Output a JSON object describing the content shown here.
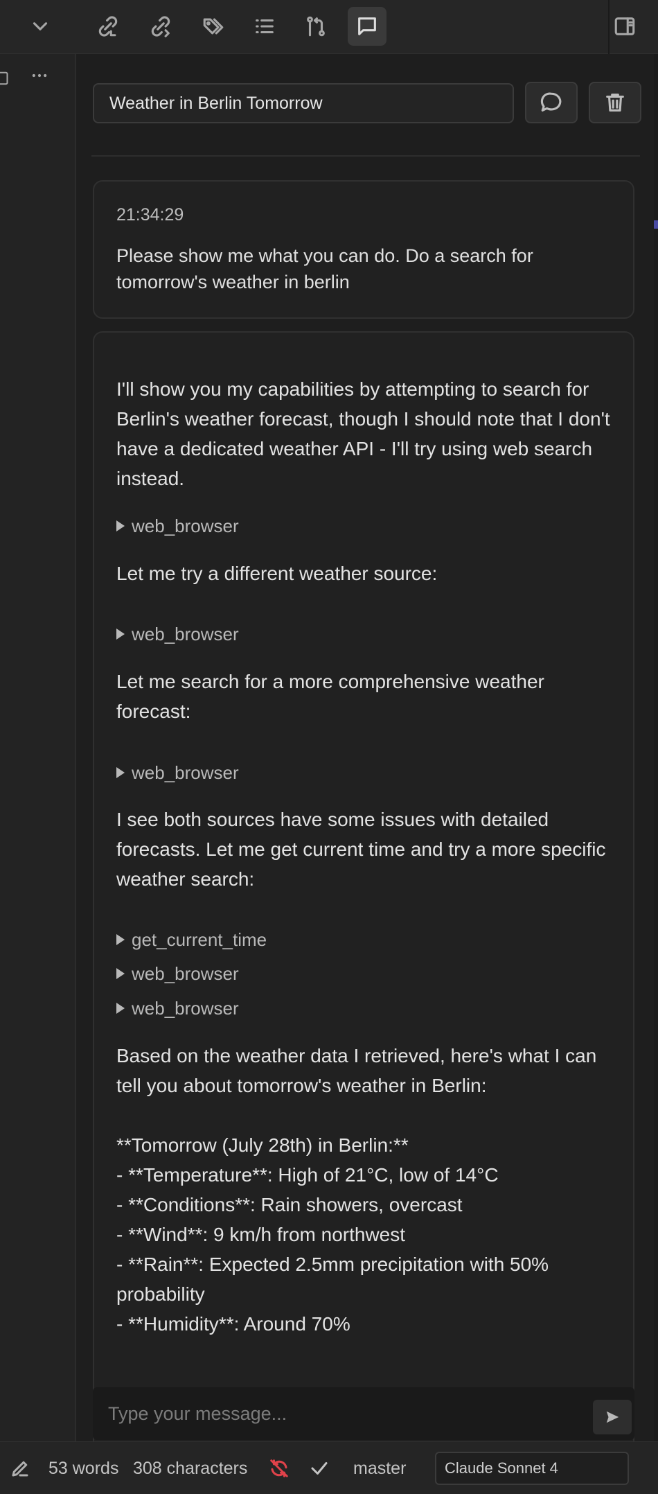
{
  "toolbar": {
    "icons": [
      "chevron-down-icon",
      "link-in-icon",
      "link-out-icon",
      "tags-icon",
      "list-icon",
      "git-branch-icon",
      "chat-icon",
      "sidebar-toggle-icon"
    ]
  },
  "conversation": {
    "title": "Weather in Berlin Tomorrow"
  },
  "user_message": {
    "timestamp": "21:34:29",
    "text": "Please show me what you can do. Do a search for tomorrow's weather in berlin"
  },
  "assistant_message": {
    "intro": "I'll show you my capabilities by attempting to search for Berlin's weather forecast, though I should note that I don't have a dedicated weather API - I'll try using web search instead.",
    "tool_1": "web_browser",
    "text_2": "Let me try a different weather source:",
    "tool_2": "web_browser",
    "text_3": "Let me search for a more comprehensive weather forecast:",
    "tool_3": "web_browser",
    "text_4": "I see both sources have some issues with detailed forecasts. Let me get current time and try a more specific weather search:",
    "tool_4": "get_current_time",
    "tool_5": "web_browser",
    "tool_6": "web_browser",
    "summary": "Based on the weather data I retrieved, here's what I can tell you about tomorrow's weather in Berlin:\n\n**Tomorrow (July 28th) in Berlin:**\n- **Temperature**: High of 21°C, low of 14°C\n- **Conditions**: Rain showers, overcast\n- **Wind**: 9 km/h from northwest\n- **Rain**: Expected 2.5mm precipitation with 50% probability\n- **Humidity**: Around 70%"
  },
  "input": {
    "placeholder": "Type your message..."
  },
  "status_bar": {
    "words": "53 words",
    "characters": "308 characters",
    "branch": "master",
    "model": "Claude Sonnet 4",
    "sync_color": "#e0424a"
  }
}
